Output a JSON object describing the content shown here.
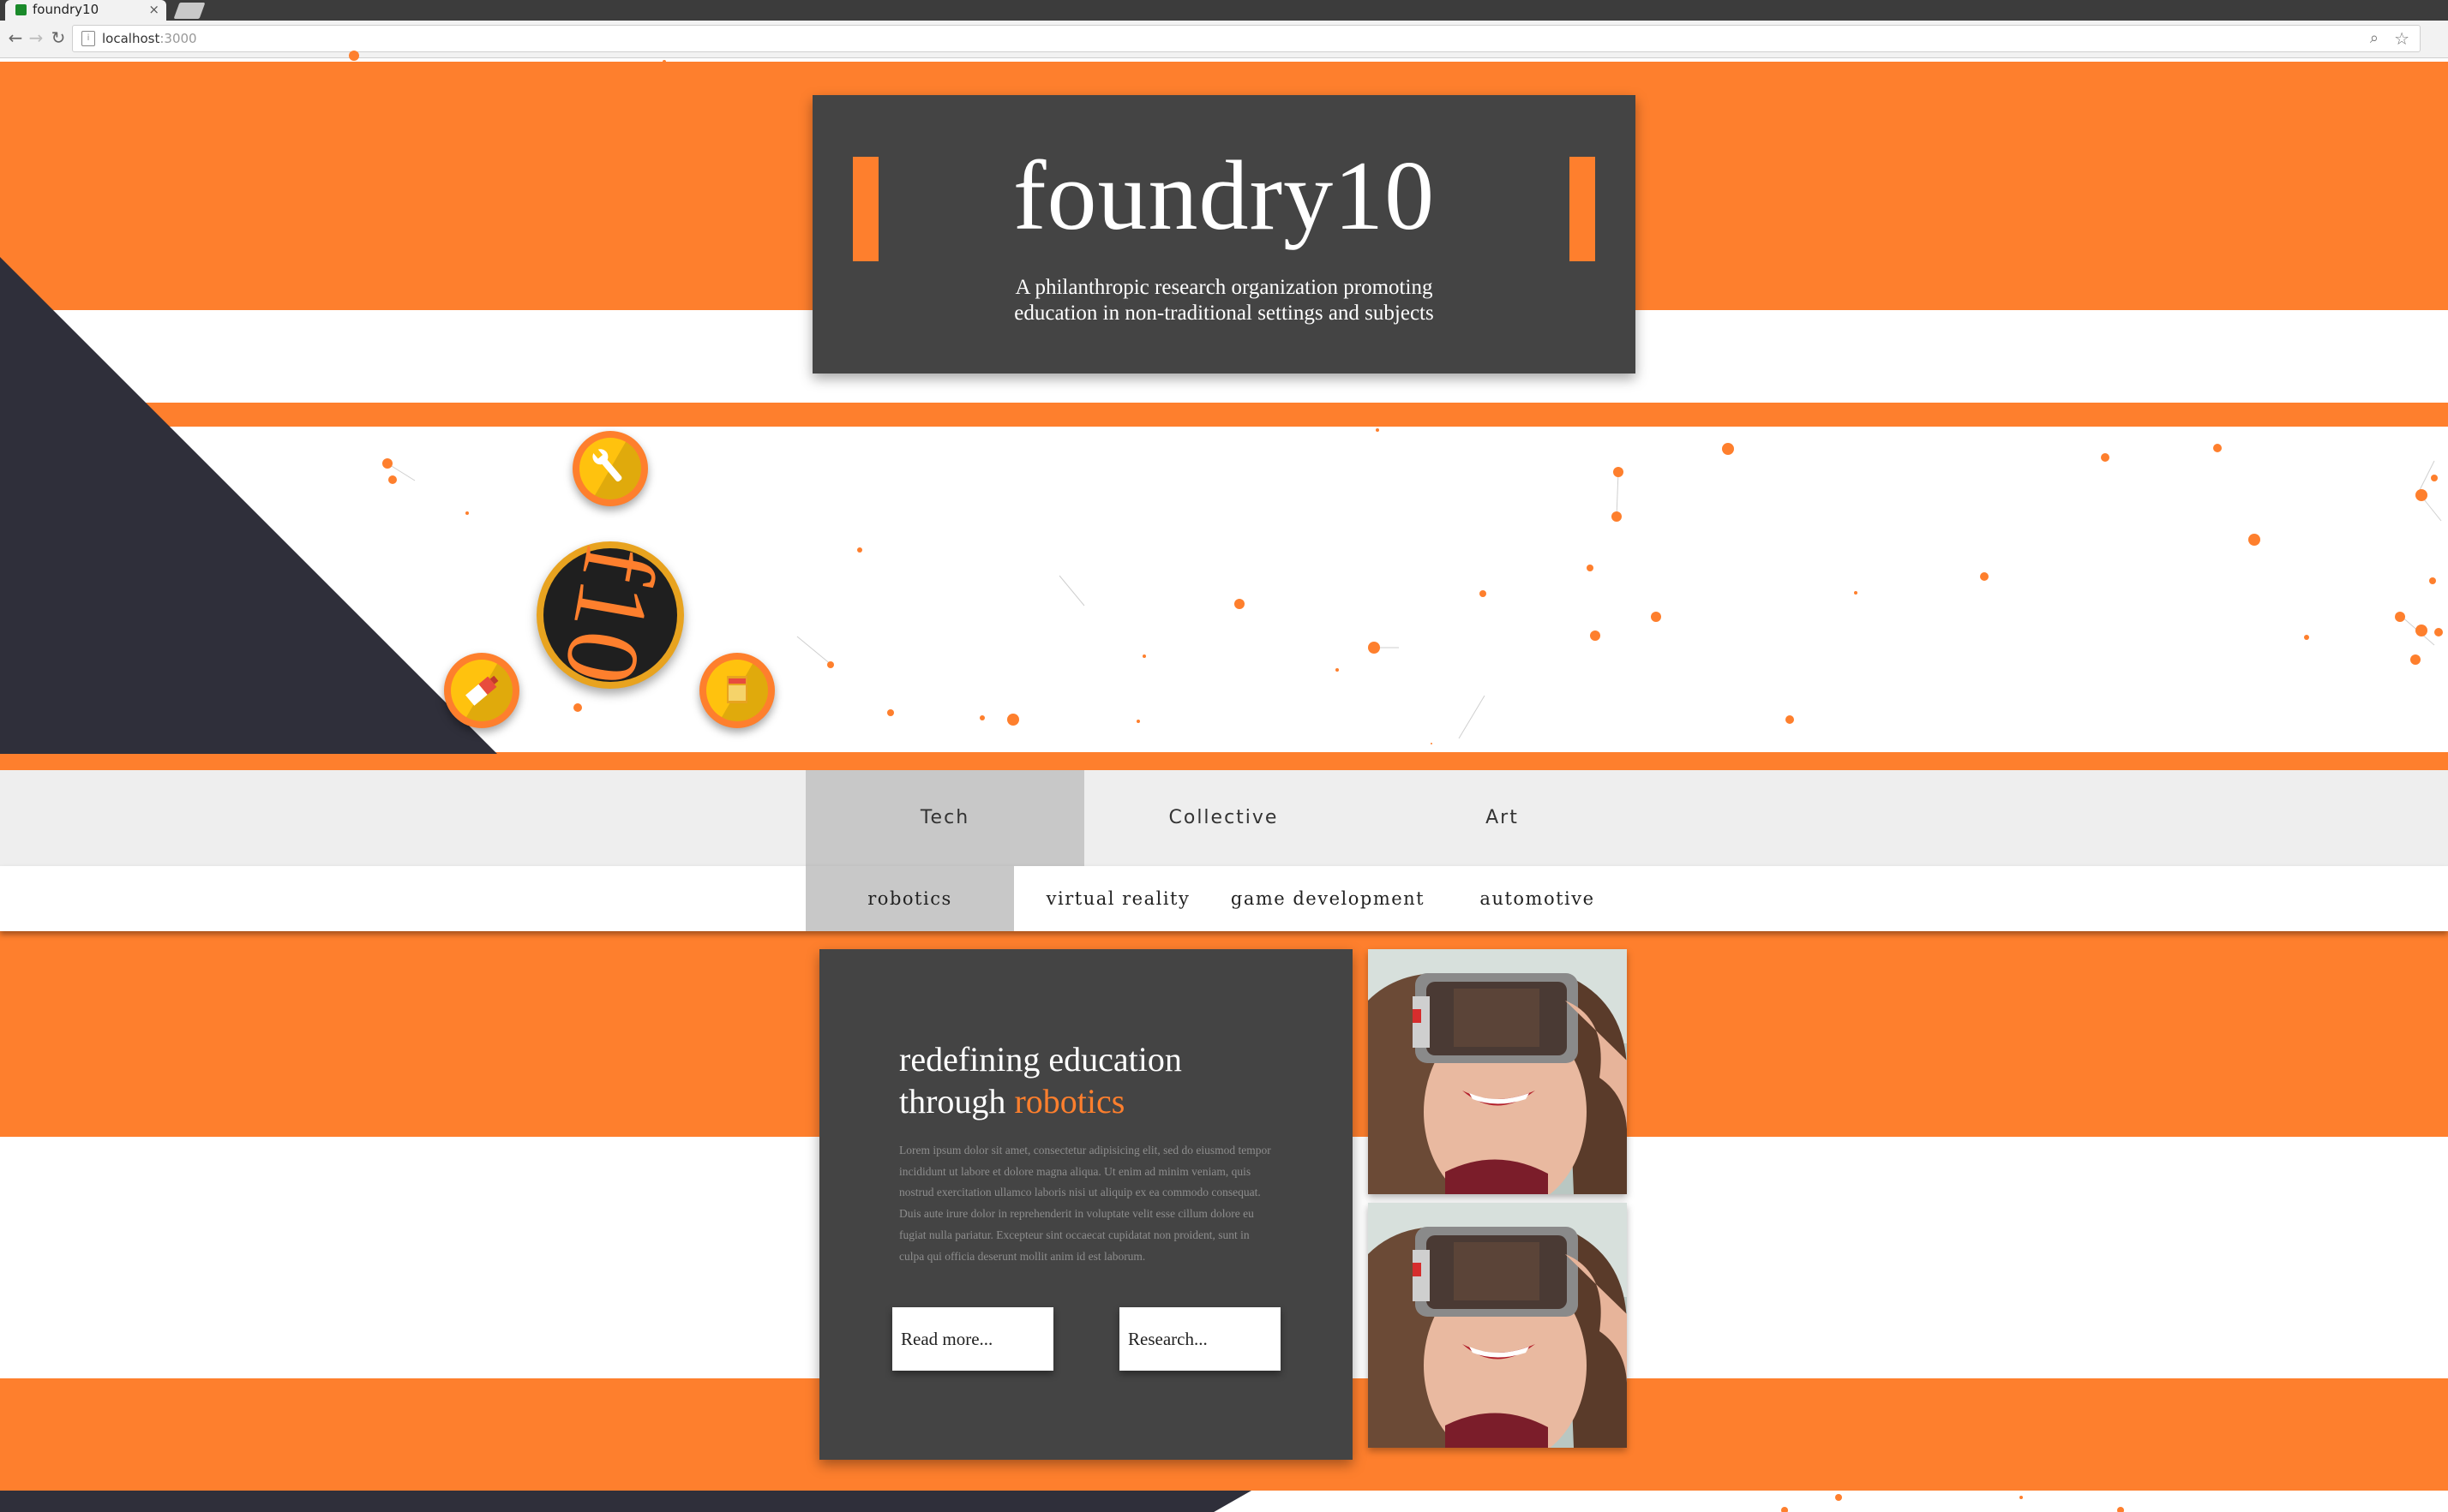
{
  "browser": {
    "tab_title": "foundry10",
    "tab_close": "×",
    "url_host": "localhost",
    "url_port": ":3000"
  },
  "header": {
    "title": "foundry10",
    "tagline": "A philanthropic research organization promoting education in non-traditional settings and subjects"
  },
  "badges": [
    {
      "name": "wrench-icon"
    },
    {
      "name": "pencil-eraser-icon"
    },
    {
      "name": "book-icon"
    }
  ],
  "logo_mark": "f10",
  "nav": {
    "primary": [
      {
        "label": "Tech",
        "active": true
      },
      {
        "label": "Collective",
        "active": false
      },
      {
        "label": "Art",
        "active": false
      }
    ],
    "secondary": [
      {
        "label": "robotics",
        "active": true
      },
      {
        "label": "virtual reality",
        "active": false
      },
      {
        "label": "game development",
        "active": false
      },
      {
        "label": "automotive",
        "active": false
      }
    ]
  },
  "content": {
    "title_line1": "redefining education",
    "title_line2_prefix": "through",
    "title_accent": "robotics",
    "body": "Lorem ipsum dolor sit amet, consectetur adipisicing elit, sed do eiusmod tempor incididunt ut labore et dolore magna aliqua. Ut enim ad minim veniam, quis nostrud exercitation ullamco laboris nisi ut aliquip ex ea commodo consequat. Duis aute irure dolor in reprehenderit in voluptate velit esse cillum dolore eu fugiat nulla pariatur. Excepteur sint occaecat cupidatat non proident, sunt in culpa qui officia deserunt mollit anim id est laborum.",
    "read_more": "Read more...",
    "research": "Research..."
  },
  "colors": {
    "accent": "#fe7f2d",
    "dark": "#444444",
    "navy": "#2f2f3a",
    "badge_yellow": "#ffc20e"
  }
}
